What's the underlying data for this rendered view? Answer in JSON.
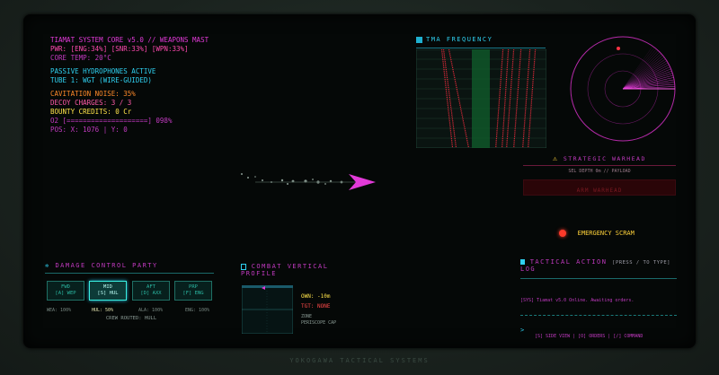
{
  "status": {
    "lines": [
      {
        "text": "TIAMAT SYSTEM CORE v5.0 // WEAPONS MAST",
        "color": "#e23ad8"
      },
      {
        "text": "PWR: [ENG:34%] [SNR:33%] [WPN:33%]",
        "color": "#ff4ab0"
      },
      {
        "text": "CORE TEMP: 20°C",
        "color": "#c23ac0"
      },
      {
        "text": "PASSIVE HYDROPHONES ACTIVE",
        "color": "#2fd0f0"
      },
      {
        "text": "TUBE 1: WGT (WIRE-GUIDED)",
        "color": "#2fd0f0"
      },
      {
        "text": "CAVITATION NOISE: 35%",
        "color": "#ff8a2a"
      },
      {
        "text": "DECOY CHARGES: 3 / 3",
        "color": "#ff5aa8"
      },
      {
        "text": "BOUNTY CREDITS: 0 Cr",
        "color": "#ffe34a"
      },
      {
        "text": "O2 [====================] 098%",
        "color": "#c23ac0"
      },
      {
        "text": "POS: X: 1076 | Y: 0",
        "color": "#c23ac0"
      }
    ]
  },
  "tma": {
    "title": "TMA FREQUENCY",
    "icon": "sonar-icon"
  },
  "radar": {
    "icon": "radar-icon",
    "contact_color": "#ff3344"
  },
  "warhead": {
    "title": "STRATEGIC WARHEAD",
    "subtitle": "SEL DEPTH 0m // PAYLOAD",
    "arm_label": "ARM WARHEAD",
    "icon": "warning-icon"
  },
  "scram": {
    "label": "EMERGENCY SCRAM",
    "icon": "scram-icon"
  },
  "damage": {
    "title": "DAMAGE CONTROL PARTY",
    "icon": "wrench-icon",
    "buttons": [
      {
        "line1": "FWD",
        "line2": "[A] WEP"
      },
      {
        "line1": "MID",
        "line2": "[S] HUL"
      },
      {
        "line1": "AFT",
        "line2": "[D] AXX"
      },
      {
        "line1": "PRP",
        "line2": "[F] ENG"
      }
    ],
    "stats": [
      "WEA: 100%",
      "HUL: 50%",
      "ALA: 100%",
      "ENG: 100%"
    ],
    "crew": "CREW ROUTED: HULL"
  },
  "combat": {
    "title": "COMBAT VERTICAL PROFILE",
    "icon": "profile-icon",
    "own": "OWN: -10m",
    "tgt": "TGT: NONE",
    "zone": "ZONE",
    "zone2": "PERISCOPE CAP"
  },
  "tactical": {
    "title": "TACTICAL ACTION",
    "hint": "[PRESS / TO TYPE]",
    "log_label": "LOG",
    "icon": "log-icon",
    "log": "[SYS] Tiamat v5.0 Online. Awaiting orders.",
    "prompt": ">",
    "footer": "[S] SIDE VIEW | [O] ORDERS | [/] COMMAND"
  },
  "bezel": {
    "label": "YOKOGAWA TACTICAL SYSTEMS"
  }
}
